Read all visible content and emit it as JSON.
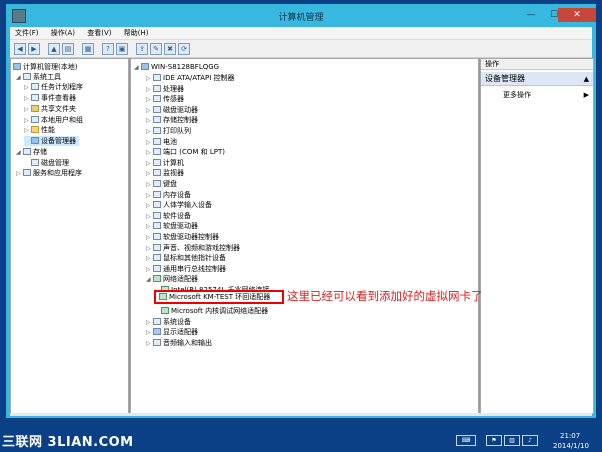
{
  "window": {
    "title": "计算机管理",
    "minimize": "—",
    "maximize": "☐",
    "close": "✕"
  },
  "menubar": [
    "文件(F)",
    "操作(A)",
    "查看(V)",
    "帮助(H)"
  ],
  "toolbar": {
    "icons": [
      "back-icon",
      "forward-icon",
      "up-icon",
      "show-hide-tree-icon",
      "properties-icon",
      "help-icon",
      "console-icon",
      "update-driver-icon",
      "disable-device-icon",
      "uninstall-device-icon",
      "scan-hardware-icon"
    ]
  },
  "left_tree": [
    {
      "label": "计算机管理(本地)",
      "level": 0,
      "expander": "",
      "icon": "pc"
    },
    {
      "label": "系统工具",
      "level": 1,
      "expander": "◢",
      "icon": "tools"
    },
    {
      "label": "任务计划程序",
      "level": 2,
      "expander": "▷",
      "icon": "clock"
    },
    {
      "label": "事件查看器",
      "level": 2,
      "expander": "▷",
      "icon": "log"
    },
    {
      "label": "共享文件夹",
      "level": 2,
      "expander": "▷",
      "icon": "folder"
    },
    {
      "label": "本地用户和组",
      "level": 2,
      "expander": "▷",
      "icon": "users"
    },
    {
      "label": "性能",
      "level": 2,
      "expander": "▷",
      "icon": "perf"
    },
    {
      "label": "设备管理器",
      "level": 2,
      "expander": "",
      "icon": "device"
    },
    {
      "label": "存储",
      "level": 1,
      "expander": "◢",
      "icon": "storage"
    },
    {
      "label": "磁盘管理",
      "level": 2,
      "expander": "",
      "icon": "disk"
    },
    {
      "label": "服务和应用程序",
      "level": 1,
      "expander": "▷",
      "icon": "services"
    }
  ],
  "device_tree": {
    "root": "WIN-S8128BFLQGG",
    "categories": [
      "IDE ATA/ATAPI 控制器",
      "处理器",
      "传感器",
      "磁盘驱动器",
      "存储控制器",
      "打印队列",
      "电池",
      "端口 (COM 和 LPT)",
      "计算机",
      "监视器",
      "键盘",
      "内存设备",
      "人体学输入设备",
      "软件设备",
      "软盘驱动器",
      "软盘驱动器控制器",
      "声音、视频和游戏控制器",
      "鼠标和其他指针设备",
      "通用串行总线控制器",
      "网络适配器"
    ],
    "network_children": [
      "Intel(R) 82574L 千兆网络连接",
      "Microsoft KM-TEST 环回适配器",
      "Microsoft 内核调试网络适配器"
    ],
    "after_network": [
      "系统设备",
      "显示适配器",
      "音频输入和输出"
    ]
  },
  "annotation": "这里已经可以看到添加好的虚拟网卡了",
  "actions": {
    "header": "操作",
    "section": "设备管理器",
    "section_arrow": "▲",
    "item": "更多操作",
    "item_arrow": "▶"
  },
  "taskbar": {
    "time": "21:07",
    "date": "2014/1/10",
    "tray_icons": [
      "keyboard-icon",
      "flag-icon",
      "network-icon",
      "volume-icon"
    ],
    "watermark": "三联网 3LIAN.COM"
  }
}
